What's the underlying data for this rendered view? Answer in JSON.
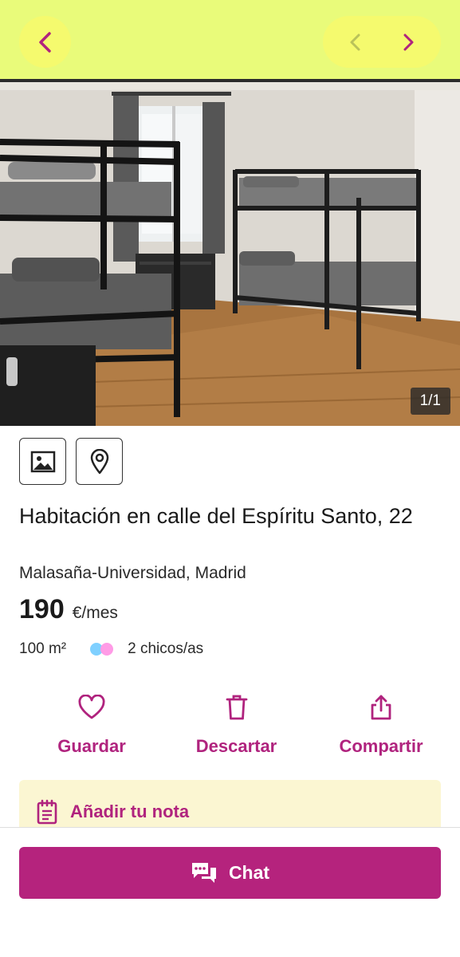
{
  "header": {
    "back_icon": "chevron-left-icon",
    "prev_icon": "chevron-left-icon",
    "next_icon": "chevron-right-icon",
    "background_color": "#e9fb7a",
    "button_color": "#f5fa6e",
    "icon_color": "#b0237e"
  },
  "gallery": {
    "counter": "1/1"
  },
  "media_buttons": [
    {
      "icon": "image-icon"
    },
    {
      "icon": "map-pin-icon"
    }
  ],
  "listing": {
    "title": "Habitación en calle del Espíritu Santo, 22",
    "location": "Malasaña-Universidad, Madrid",
    "price": "190",
    "price_unit": "€/mes",
    "size": "100 m²",
    "occupants": "2 chicos/as"
  },
  "actions": {
    "save": {
      "label": "Guardar",
      "icon": "heart-icon"
    },
    "discard": {
      "label": "Descartar",
      "icon": "trash-icon"
    },
    "share": {
      "label": "Compartir",
      "icon": "share-icon"
    }
  },
  "note": {
    "label": "Añadir tu nota",
    "icon": "notepad-icon",
    "background_color": "#fbf6d2"
  },
  "chat": {
    "label": "Chat",
    "icon": "chat-bubbles-icon",
    "button_color": "#b5237d"
  },
  "accent_color": "#b0237e"
}
